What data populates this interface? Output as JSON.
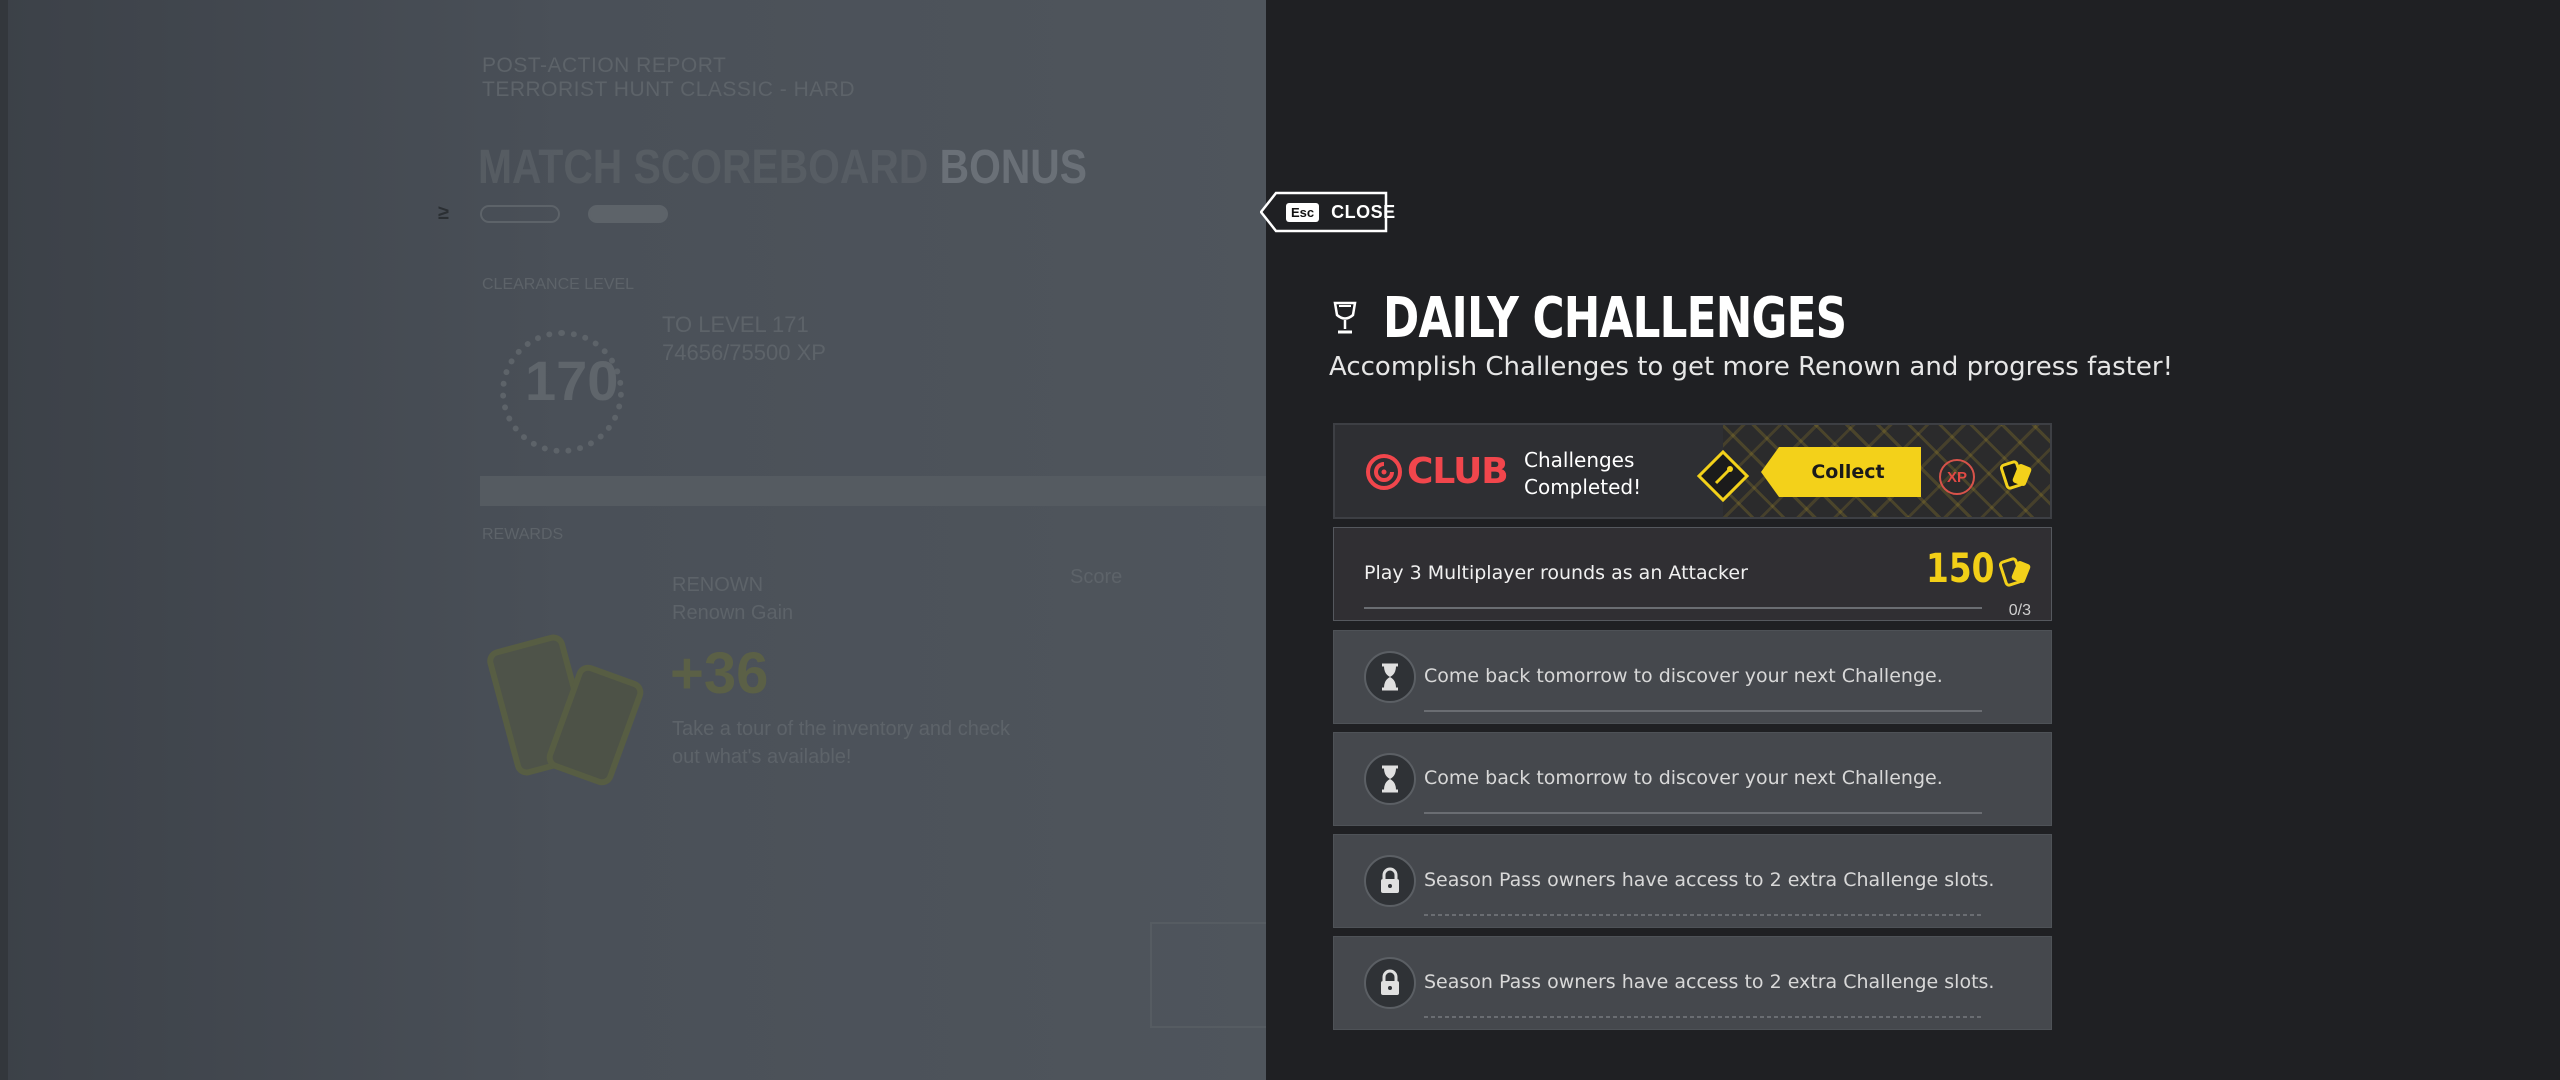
{
  "background": {
    "report_title": "POST-ACTION REPORT",
    "report_subtitle": "TERRORIST HUNT CLASSIC - HARD",
    "tab_scoreboard": "MATCH SCOREBOARD",
    "tab_bonus": "BONUS",
    "clearance_label": "CLEARANCE LEVEL",
    "level": "170",
    "to_level": "TO LEVEL 171",
    "xp_progress": "74656/75500 XP",
    "rewards_label": "REWARDS",
    "renown_title": "RENOWN",
    "renown_gain": "Renown Gain",
    "renown_amount": "+36",
    "renown_tip_line1": "Take a tour of the inventory and check",
    "renown_tip_line2": "out what's available!",
    "score_label": "Score"
  },
  "overlay": {
    "close_key": "Esc",
    "close_label": "CLOSE",
    "title": "DAILY CHALLENGES",
    "subtitle": "Accomplish Challenges to get more Renown and progress faster!",
    "club": {
      "brand": "CLUB",
      "status_line1": "Challenges",
      "status_line2": "Completed!",
      "collect_label": "Collect",
      "xp_badge": "XP"
    },
    "challenges": [
      {
        "label": "Play 3 Multiplayer rounds as an Attacker",
        "reward": "150",
        "progress": "0/3",
        "progress_fraction": 0,
        "icon": "renown-icon"
      },
      {
        "label": "Come back tomorrow to discover your next Challenge.",
        "icon": "hourglass-icon"
      },
      {
        "label": "Come back tomorrow to discover your next Challenge.",
        "icon": "hourglass-icon"
      },
      {
        "label": "Season Pass owners have access to 2 extra Challenge slots.",
        "icon": "lock-icon"
      },
      {
        "label": "Season Pass owners have access to 2 extra Challenge slots.",
        "icon": "lock-icon"
      }
    ]
  },
  "colors": {
    "accent_yellow": "#f3d11a",
    "club_red": "#f1464c",
    "panel_bg": "#1f2023"
  }
}
